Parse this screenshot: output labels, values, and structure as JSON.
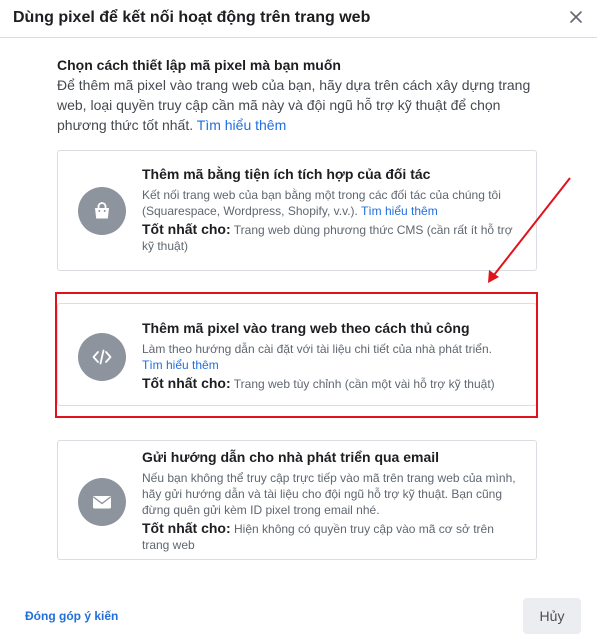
{
  "dialog": {
    "title": "Dùng pixel để kết nối hoạt động trên trang web"
  },
  "intro": {
    "heading": "Chọn cách thiết lập mã pixel mà bạn muốn",
    "body": "Để thêm mã pixel vào trang web của bạn, hãy dựa trên cách xây dựng trang web, loại quyền truy cập cần mã này và đội ngũ hỗ trợ kỹ thuật để chọn phương thức tốt nhất.",
    "link": "Tìm hiểu thêm"
  },
  "options": [
    {
      "title": "Thêm mã bằng tiện ích tích hợp của đối tác",
      "description": "Kết nối trang web của bạn bằng một trong các đối tác của chúng tôi (Squarespace, Wordpress, Shopify, v.v.).",
      "link": "Tìm hiểu thêm",
      "best_label": "Tốt nhất cho:",
      "best_text": "Trang web dùng phương thức CMS (cần rất ít hỗ trợ kỹ thuật)",
      "icon": "shopping-bag-icon"
    },
    {
      "title": "Thêm mã pixel vào trang web theo cách thủ công",
      "description": "Làm theo hướng dẫn cài đặt với tài liệu chi tiết của nhà phát triển.",
      "link": "Tìm hiểu thêm",
      "best_label": "Tốt nhất cho:",
      "best_text": "Trang web tùy chỉnh (cần một vài hỗ trợ kỹ thuật)",
      "icon": "code-icon"
    },
    {
      "title": "Gửi hướng dẫn cho nhà phát triển qua email",
      "description": "Nếu bạn không thể truy cập trực tiếp vào mã trên trang web của mình, hãy gửi hướng dẫn và tài liệu cho đội ngũ hỗ trợ kỹ thuật. Bạn cũng đừng quên gửi kèm ID pixel trong email nhé.",
      "best_label": "Tốt nhất cho:",
      "best_text": "Hiện không có quyền truy cập vào mã cơ sở trên trang web",
      "icon": "envelope-icon"
    }
  ],
  "footer": {
    "feedback": "Đóng góp ý kiến",
    "cancel": "Hủy"
  },
  "colors": {
    "link": "#216fdb",
    "icon_circle": "#8d949e",
    "annotation": "#e0131c",
    "border": "#dadde1"
  }
}
